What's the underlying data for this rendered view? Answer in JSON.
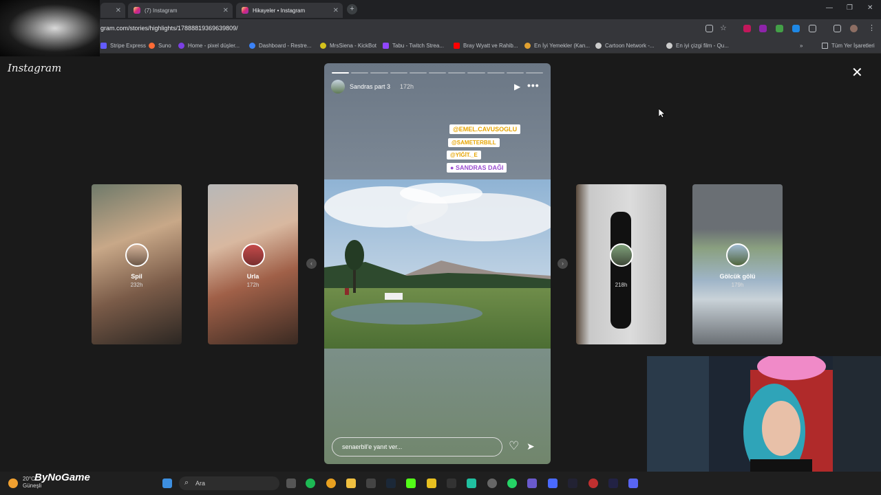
{
  "browser": {
    "tabs": [
      {
        "label": ""
      },
      {
        "label": "(7) Instagram"
      },
      {
        "label": "Hikayeler • Instagram"
      }
    ],
    "url": "gram.com/stories/highlights/17888819369639809/",
    "bookmarks": [
      {
        "label": "Stripe Express",
        "color": "#635bff"
      },
      {
        "label": "Suno",
        "color": "#ff6b35"
      },
      {
        "label": "Home - pixel düşler...",
        "color": "#7b3fe4"
      },
      {
        "label": "Dashboard - Restre...",
        "color": "#3b82f6"
      },
      {
        "label": "MrsSiena - KickBot",
        "color": "#d4c21c"
      },
      {
        "label": "Tabu - Twitch Strea...",
        "color": "#9146ff"
      },
      {
        "label": "Bray Wyatt ve Rahib...",
        "color": "#ff0000"
      },
      {
        "label": "En İyi Yemekler (Kan...",
        "color": "#e0a030"
      },
      {
        "label": "Cartoon Network -...",
        "color": "#cccccc"
      },
      {
        "label": "En iyi çizgi film - Qu...",
        "color": "#cccccc"
      }
    ],
    "bookmarks_all": "Tüm Yer İşaretleri"
  },
  "instagram": {
    "logo": "Instagram",
    "story": {
      "username": "Sandras part 3",
      "time": "172h",
      "progress_segments": 11,
      "progress_done": 1,
      "tags": [
        "@EMEL.CAVUSOGLU",
        "@SAMETERBILL",
        "@YİĞİT._E",
        "SANDRAS DAĞI"
      ],
      "reply_placeholder": "senaerbll'e yanıt ver..."
    },
    "side_stories": [
      {
        "label": "Spil",
        "time": "232h"
      },
      {
        "label": "Urla",
        "time": "172h"
      },
      {
        "label": "",
        "time": "218h"
      },
      {
        "label": "Gölcük gölü",
        "time": "179h"
      }
    ]
  },
  "taskbar": {
    "weather_temp": "20°C",
    "weather_desc": "Güneşli",
    "brand": "ByNoGame",
    "search_placeholder": "Ara"
  }
}
